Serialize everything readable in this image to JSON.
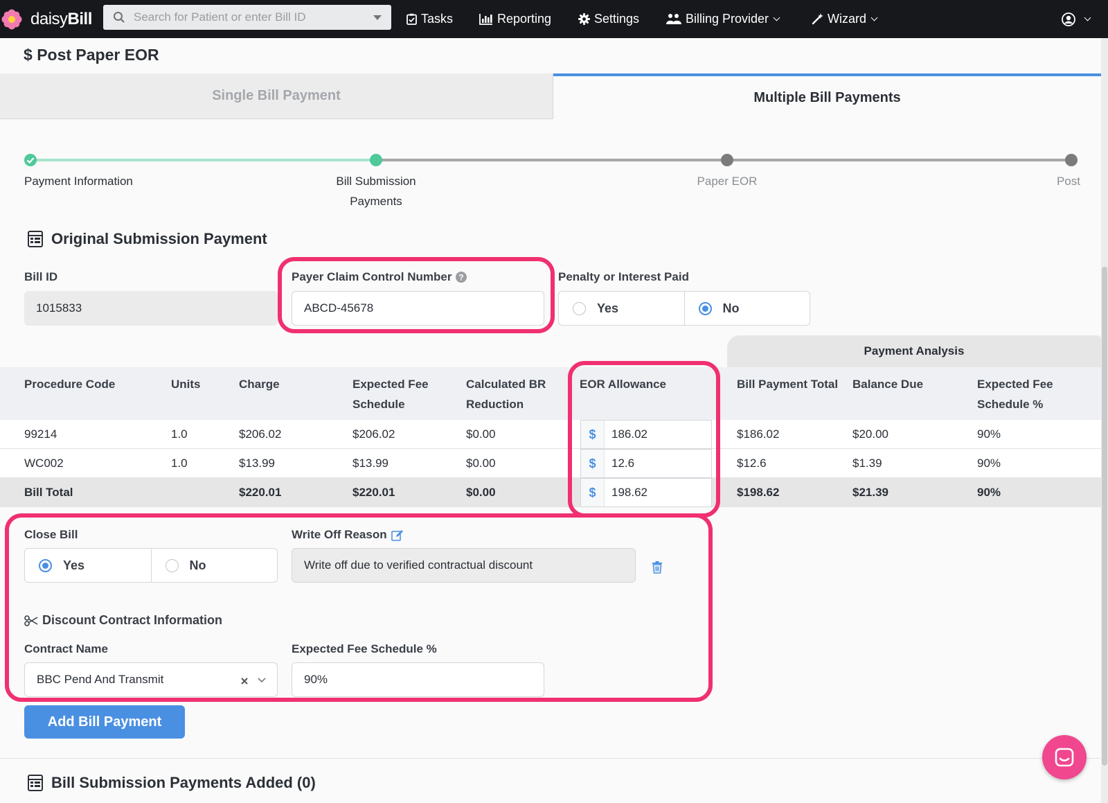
{
  "app": {
    "name_light": "daisy",
    "name_bold": "Bill"
  },
  "search": {
    "placeholder": "Search for Patient or enter Bill ID"
  },
  "nav": {
    "tasks": "Tasks",
    "reporting": "Reporting",
    "settings": "Settings",
    "billing_provider": "Billing Provider",
    "wizard": "Wizard"
  },
  "page": {
    "title_symbol": "$",
    "title": "Post Paper EOR"
  },
  "tabs": {
    "single": "Single Bill Payment",
    "multiple": "Multiple Bill Payments",
    "active": "multiple"
  },
  "stepper": {
    "steps": [
      {
        "label": "Payment Information",
        "state": "complete"
      },
      {
        "label": "Bill Submission Payments",
        "state": "current"
      },
      {
        "label": "Paper EOR",
        "state": "pending"
      },
      {
        "label": "Post",
        "state": "pending"
      }
    ]
  },
  "original": {
    "title": "Original Submission Payment",
    "bill_id_label": "Bill ID",
    "bill_id": "1015833",
    "pccn_label": "Payer Claim Control Number",
    "pccn": "ABCD-45678",
    "penalty_label": "Penalty or Interest Paid",
    "penalty_yes": "Yes",
    "penalty_no": "No",
    "penalty_selected": "No"
  },
  "table": {
    "payment_analysis": "Payment Analysis",
    "headers": {
      "procedure": "Procedure Code",
      "units": "Units",
      "charge": "Charge",
      "efs_1": "Expected Fee",
      "efs_2": "Schedule",
      "br_1": "Calculated BR",
      "br_2": "Reduction",
      "eor": "EOR Allowance",
      "total": "Bill Payment Total",
      "balance": "Balance Due",
      "efsp_1": "Expected Fee",
      "efsp_2": "Schedule %"
    },
    "currency_symbol": "$",
    "rows": [
      {
        "code": "99214",
        "units": "1.0",
        "charge": "$206.02",
        "efs": "$206.02",
        "br": "$0.00",
        "eor": "186.02",
        "total": "$186.02",
        "balance": "$20.00",
        "pct": "90%"
      },
      {
        "code": "WC002",
        "units": "1.0",
        "charge": "$13.99",
        "efs": "$13.99",
        "br": "$0.00",
        "eor": "12.6",
        "total": "$12.6",
        "balance": "$1.39",
        "pct": "90%"
      }
    ],
    "footer": {
      "label": "Bill Total",
      "charge": "$220.01",
      "efs": "$220.01",
      "br": "$0.00",
      "eor": "198.62",
      "total": "$198.62",
      "balance": "$21.39",
      "pct": "90%"
    }
  },
  "close": {
    "label": "Close Bill",
    "yes": "Yes",
    "no": "No",
    "selected": "Yes",
    "writeoff_label": "Write Off Reason",
    "writeoff_value": "Write off due to verified contractual discount"
  },
  "discount": {
    "title": "Discount Contract Information",
    "contract_label": "Contract Name",
    "contract_value": "BBC Pend And Transmit",
    "efs_label": "Expected Fee Schedule %",
    "efs_value": "90%"
  },
  "add_button": "Add Bill Payment",
  "added": {
    "title": "Bill Submission Payments Added (0)"
  },
  "colors": {
    "accent": "#4a90e2",
    "highlight": "#f0306f",
    "step_done": "#4fc99a",
    "brand_pink": "#f0478f"
  }
}
